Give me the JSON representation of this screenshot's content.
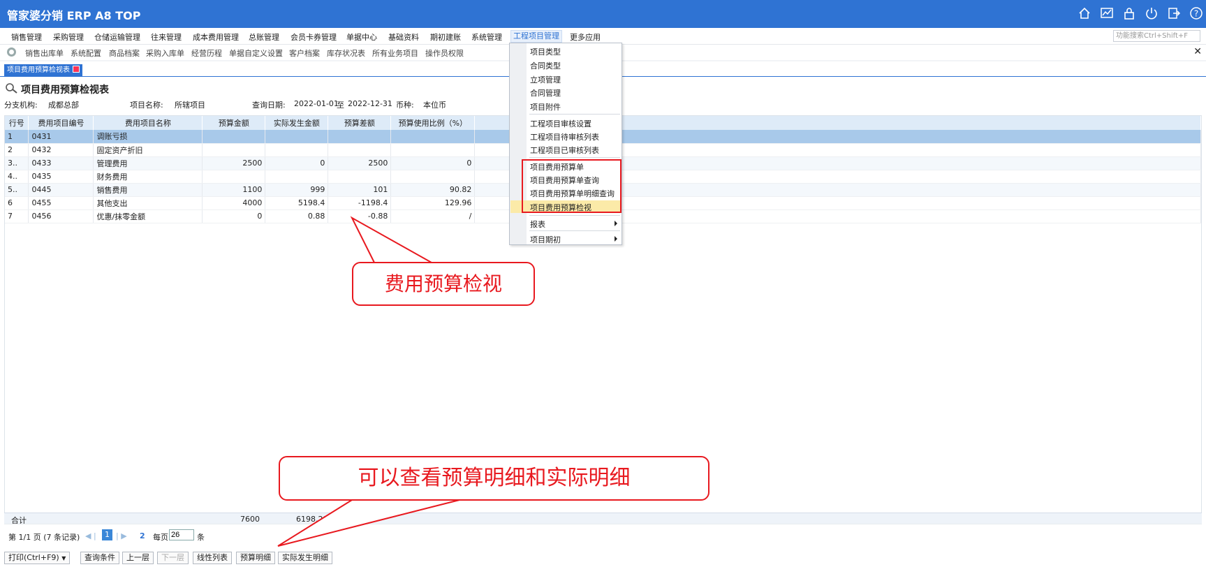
{
  "app": {
    "title": "管家婆分销 ERP A8 TOP"
  },
  "header_icons": [
    "home-icon",
    "chart-icon",
    "lock-icon",
    "power-icon",
    "exit-icon",
    "help-icon"
  ],
  "menu": [
    "销售管理",
    "采购管理",
    "仓储运输管理",
    "往来管理",
    "成本费用管理",
    "总账管理",
    "会员卡券管理",
    "单据中心",
    "基础资料",
    "期初建账",
    "系统管理",
    "工程项目管理",
    "更多应用"
  ],
  "search_placeholder": "功能搜索Ctrl+Shift+F",
  "quick": [
    "销售出库单",
    "系统配置",
    "商品档案",
    "采购入库单",
    "经营历程",
    "单据自定义设置",
    "客户档案",
    "库存状况表",
    "所有业务项目",
    "操作员权限"
  ],
  "tab": {
    "label": "项目费用预算检视表"
  },
  "page": {
    "title": "项目费用预算检视表",
    "branch_label": "分支机构:",
    "branch": "成都总部",
    "project_label": "项目名称:",
    "project": "所辖项目",
    "date_label": "查询日期:",
    "date_from": "2022-01-01",
    "date_to_sep": "至",
    "date_to": "2022-12-31",
    "currency_label": "币种:",
    "currency": "本位币"
  },
  "table": {
    "headers": [
      "行号",
      "费用项目编号",
      "费用项目名称",
      "预算金额",
      "实际发生金额",
      "预算差额",
      "预算使用比例（%）"
    ],
    "rows": [
      [
        "1",
        "0431",
        "调账亏损",
        "",
        "",
        "",
        ""
      ],
      [
        "2",
        "0432",
        "固定资产折旧",
        "",
        "",
        "",
        ""
      ],
      [
        "3..",
        "0433",
        "管理费用",
        "2500",
        "0",
        "2500",
        "0"
      ],
      [
        "4..",
        "0435",
        "财务费用",
        "",
        "",
        "",
        ""
      ],
      [
        "5..",
        "0445",
        "销售费用",
        "1100",
        "999",
        "101",
        "90.82"
      ],
      [
        "6",
        "0455",
        "其他支出",
        "4000",
        "5198.4",
        "-1198.4",
        "129.96"
      ],
      [
        "7",
        "0456",
        "优惠/抹零金额",
        "0",
        "0.88",
        "-0.88",
        "/"
      ]
    ],
    "total_label": "合计",
    "total_budget": "7600",
    "total_actual": "6198.28"
  },
  "pager": {
    "text": "第 1/1 页 (7 条记录)",
    "current": "1",
    "goto": "2",
    "per_page_label": "每页",
    "per_page": "26",
    "unit": "条"
  },
  "buttons": [
    "打印(Ctrl+F9)",
    "查询条件",
    "上一层",
    "下一层",
    "线性列表",
    "预算明细",
    "实际发生明细"
  ],
  "dropdown": {
    "group1": [
      "项目类型",
      "合同类型",
      "立项管理",
      "合同管理",
      "项目附件"
    ],
    "group2": [
      "工程项目审核设置",
      "工程项目待审核列表",
      "工程项目已审核列表"
    ],
    "group3": [
      "项目费用预算单",
      "项目费用预算单查询",
      "项目费用预算单明细查询",
      "项目费用预算检视"
    ],
    "group4": [
      "报表",
      "项目期初"
    ]
  },
  "callouts": {
    "c1": "费用预算检视",
    "c2": "可以查看预算明细和实际明细"
  },
  "colors": {
    "brand": "#2f73d3",
    "annotation": "#e8191f",
    "highlight": "#fbeaa8"
  }
}
